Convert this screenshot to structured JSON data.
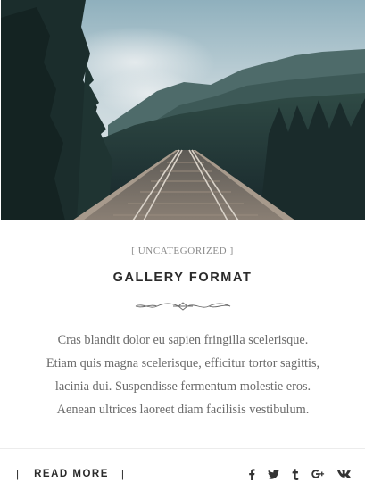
{
  "post": {
    "category": "UNCATEGORIZED",
    "category_open": "[",
    "category_close": "]",
    "title": "GALLERY FORMAT",
    "excerpt_lines": [
      "Cras blandit dolor eu sapien fringilla scelerisque.",
      "Etiam quis magna scelerisque, efficitur tortor sagittis,",
      "lacinia dui. Suspendisse fermentum molestie eros.",
      "Aenean ultrices laoreet diam facilisis vestibulum."
    ]
  },
  "footer": {
    "separator": "|",
    "read_more_label": "READ MORE",
    "share_icons": [
      "facebook-icon",
      "twitter-icon",
      "tumblr-icon",
      "google-plus-icon",
      "vk-icon"
    ]
  },
  "colors": {
    "title": "#2a2a2a",
    "text": "#6b6b6b",
    "meta": "#8a8a8a",
    "rule": "#ececec"
  }
}
